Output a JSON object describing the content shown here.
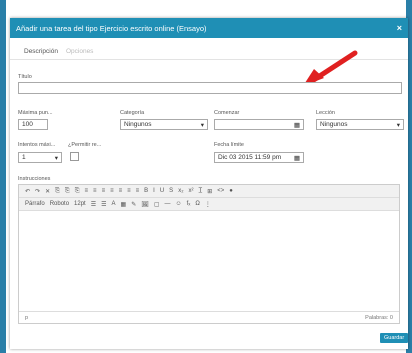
{
  "dialog": {
    "title": "Añadir una tarea del tipo Ejercicio escrito online (Ensayo)",
    "close_label": "×"
  },
  "tabs": [
    {
      "label": "Descripción"
    },
    {
      "label": "Opciones"
    }
  ],
  "fields": {
    "title_label": "Título",
    "title_value": "",
    "max_points_label": "Máxima pun...",
    "max_points_value": "100",
    "category_label": "Categoría",
    "category_value": "Ningunos",
    "start_label": "Comenzar",
    "start_value": "",
    "lesson_label": "Lección",
    "lesson_value": "Ningunos",
    "attempts_label": "Intentos máxi...",
    "attempts_value": "1",
    "allow_label": "¿Permitir re...",
    "deadline_label": "Fecha límite",
    "deadline_value": "Dic 03 2015 11:59 pm",
    "instructions_label": "Instrucciones"
  },
  "editor": {
    "toolbar1": [
      "↶",
      "↷",
      "✕",
      "⎘",
      "⎘",
      "⎘",
      "≡",
      "≡",
      "≡",
      "≡",
      "≡",
      "≡",
      "≡",
      "B",
      "I",
      "U",
      "S",
      "x₂",
      "x²",
      "T̲",
      "⊞",
      "<>",
      "●"
    ],
    "toolbar2": [
      "Párrafo",
      "Roboto",
      "12pt",
      "☰",
      "☰",
      "A",
      "▦",
      "✎",
      "🖼",
      "▢",
      "—",
      "☺",
      "fₓ",
      "Ω",
      "⋮"
    ],
    "status_left": "p",
    "status_right": "Palabras: 0"
  },
  "footer": {
    "save_label": "Guardar"
  },
  "colors": {
    "header": "#1f8fb5",
    "arrow": "#e02020"
  }
}
